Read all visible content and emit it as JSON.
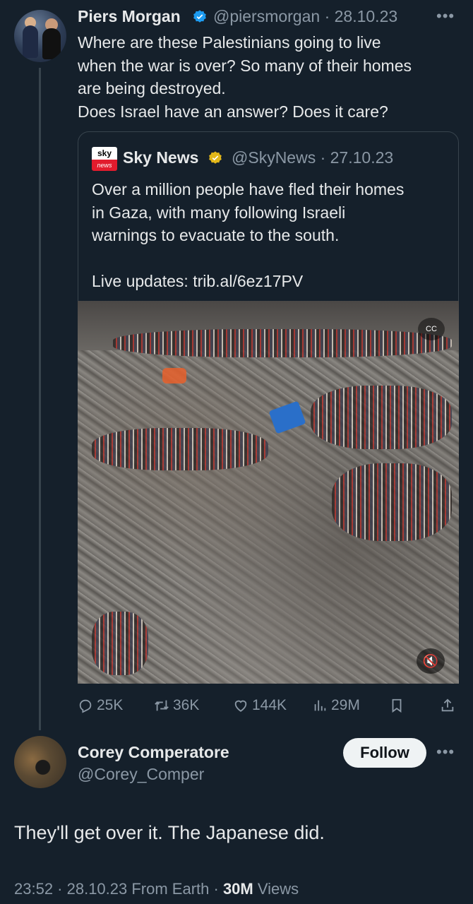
{
  "parent": {
    "name": "Piers Morgan",
    "handle": "@piersmorgan",
    "date": "· 28.10.23",
    "more": "•••",
    "text": "Where are these Palestinians going to live\nwhen the war is over? So many of their homes\nare being destroyed.\nDoes Israel have an answer? Does it care?"
  },
  "quote": {
    "logo_top": "sky",
    "logo_bottom": "news",
    "name": "Sky News",
    "handle": "@SkyNews",
    "date": "· 27.10.23",
    "text": "Over a million people have fled their homes\nin Gaza, with many following Israeli\nwarnings to evacuate to the south.\n\nLive updates: trib.al/6ez17PV",
    "cc_label": "CC",
    "mute_label": "🔇"
  },
  "actions": {
    "replies": "25K",
    "retweets": "36K",
    "likes": "144K",
    "views": "29M"
  },
  "reply": {
    "name": "Corey Comperatore",
    "handle": "@Corey_Comper",
    "follow_label": "Follow",
    "more": "•••",
    "text": "They'll get over it. The Japanese did.",
    "meta_prefix": "23:52 · 28.10.23 From Earth · ",
    "meta_views": "30M",
    "meta_suffix": " Views"
  },
  "colors": {
    "background": "#15202b",
    "verified": "#1d9bf0",
    "gold_verified": "#e2b719",
    "secondary_text": "#8b98a5"
  },
  "icons": [
    "reply-icon",
    "retweet-icon",
    "like-icon",
    "views-icon",
    "bookmark-icon",
    "share-icon",
    "verified-icon",
    "cc-icon",
    "mute-icon"
  ]
}
